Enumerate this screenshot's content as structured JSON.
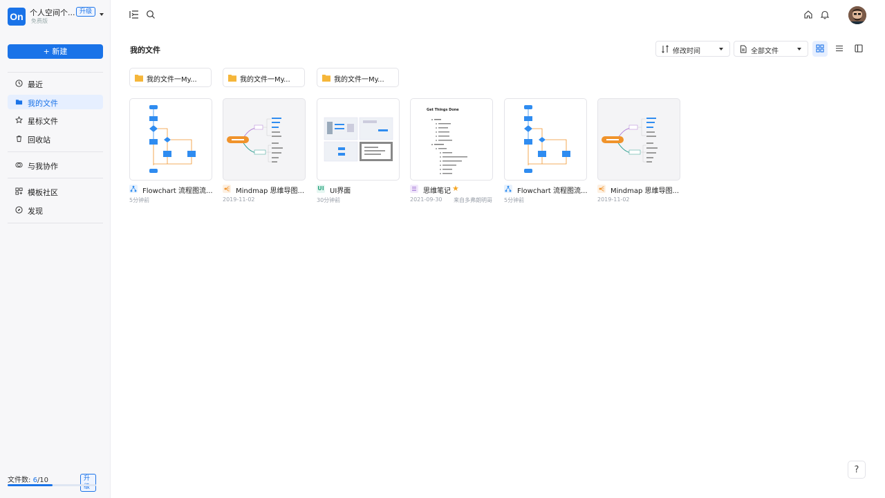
{
  "workspace": {
    "name": "个人空间个...",
    "upgrade_label": "升级",
    "plan": "免费版",
    "logo_text": "On"
  },
  "sidebar": {
    "new_label": "新建",
    "items": [
      {
        "label": "最近",
        "icon": "clock-icon"
      },
      {
        "label": "我的文件",
        "icon": "folder-icon",
        "active": true
      },
      {
        "label": "星标文件",
        "icon": "star-icon"
      },
      {
        "label": "回收站",
        "icon": "trash-icon"
      },
      {
        "label": "与我协作",
        "icon": "collab-icon"
      },
      {
        "label": "模板社区",
        "icon": "template-icon"
      },
      {
        "label": "发现",
        "icon": "compass-icon"
      }
    ],
    "quota": {
      "label": "文件数: ",
      "used": "6",
      "total": "/10",
      "used_fraction": 0.6,
      "upgrade_label": "升级"
    }
  },
  "main": {
    "title": "我的文件",
    "sort": {
      "label": "修改时间"
    },
    "filter": {
      "label": "全部文件"
    },
    "folders": [
      {
        "name": "我的文件一My..."
      },
      {
        "name": "我的文件一My..."
      },
      {
        "name": "我的文件一My..."
      }
    ],
    "files": [
      {
        "title": "Flowchart 流程图流...",
        "meta": "5分钟前",
        "meta2": "",
        "kind": "flowchart"
      },
      {
        "title": "Mindmap 思维导图...",
        "meta": "2019-11-02",
        "meta2": "",
        "kind": "mindmap"
      },
      {
        "title": "UI界面",
        "meta": "30分钟前",
        "meta2": "",
        "kind": "ui"
      },
      {
        "title": "思维笔记",
        "meta": "2021-09-30",
        "meta2": "来自多弗朗明哥",
        "kind": "note",
        "starred": true,
        "note_heading": "Get Things Done"
      },
      {
        "title": "Flowchart 流程图流...",
        "meta": "5分钟前",
        "meta2": "",
        "kind": "flowchart"
      },
      {
        "title": "Mindmap 思维导图...",
        "meta": "2019-11-02",
        "meta2": "",
        "kind": "mindmap"
      }
    ]
  },
  "help": {
    "label": "?"
  },
  "colors": {
    "accent": "#1a73e8",
    "folder": "#f5b63a",
    "star": "#f5a623",
    "mindmap_orange": "#f0932b"
  }
}
